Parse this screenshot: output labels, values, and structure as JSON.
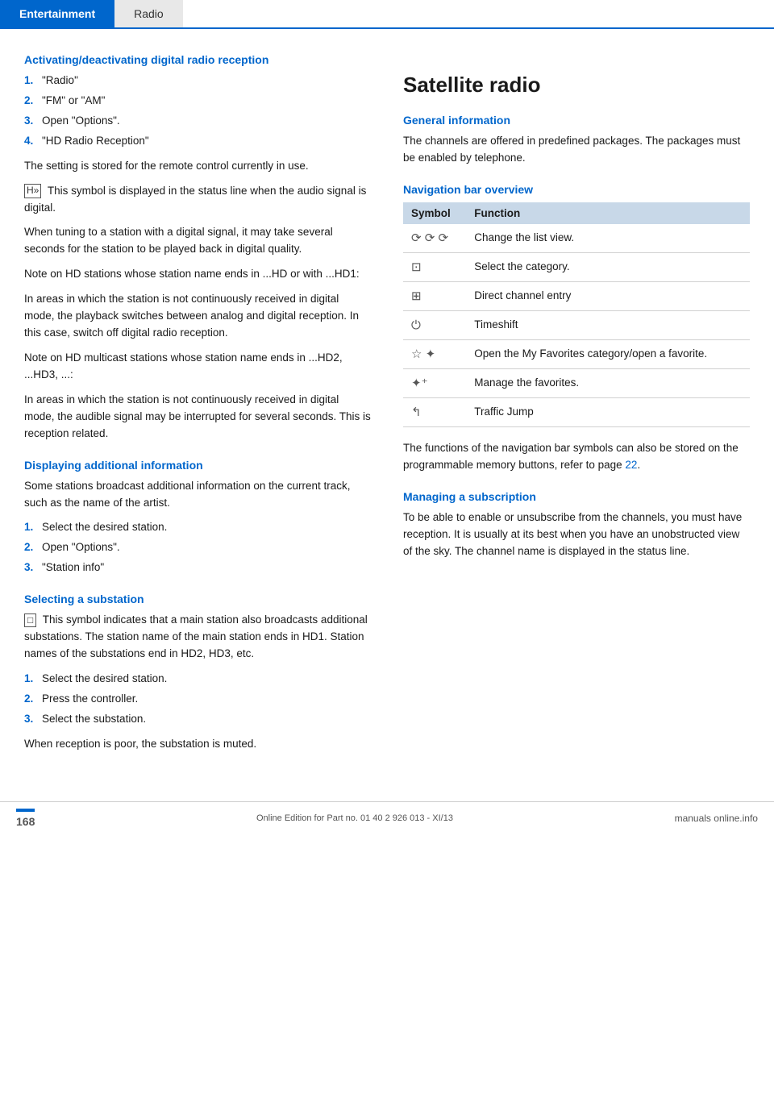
{
  "header": {
    "tab_active": "Entertainment",
    "tab_inactive": "Radio"
  },
  "left_col": {
    "section1_title": "Activating/deactivating digital radio reception",
    "section1_steps": [
      {
        "num": "1.",
        "text": "\"Radio\""
      },
      {
        "num": "2.",
        "text": "\"FM\" or \"AM\""
      },
      {
        "num": "3.",
        "text": "Open \"Options\"."
      },
      {
        "num": "4.",
        "text": "\"HD Radio Reception\""
      }
    ],
    "section1_para1": "The setting is stored for the remote control currently in use.",
    "section1_para2": "This symbol is displayed in the status line when the audio signal is digital.",
    "section1_para3": "When tuning to a station with a digital signal, it may take several seconds for the station to be played back in digital quality.",
    "section1_para4": "Note on HD stations whose station name ends in ...HD or with ...HD1:",
    "section1_para5": "In areas in which the station is not continuously received in digital mode, the playback switches between analog and digital reception. In this case, switch off digital radio reception.",
    "section1_para6": "Note on HD multicast stations whose station name ends in ...HD2, ...HD3, ...:",
    "section1_para7": "In areas in which the station is not continuously received in digital mode, the audible signal may be interrupted for several seconds. This is reception related.",
    "section2_title": "Displaying additional information",
    "section2_para1": "Some stations broadcast additional information on the current track, such as the name of the artist.",
    "section2_steps": [
      {
        "num": "1.",
        "text": "Select the desired station."
      },
      {
        "num": "2.",
        "text": "Open \"Options\"."
      },
      {
        "num": "3.",
        "text": "\"Station info\""
      }
    ],
    "section3_title": "Selecting a substation",
    "section3_para1": "This symbol indicates that a main station also broadcasts additional substations. The station name of the main station ends in HD1. Station names of the substations end in HD2, HD3, etc.",
    "section3_steps": [
      {
        "num": "1.",
        "text": "Select the desired station."
      },
      {
        "num": "2.",
        "text": "Press the controller."
      },
      {
        "num": "3.",
        "text": "Select the substation."
      }
    ],
    "section3_para2": "When reception is poor, the substation is muted."
  },
  "right_col": {
    "big_title": "Satellite radio",
    "section1_title": "General information",
    "section1_para": "The channels are offered in predefined packages. The packages must be enabled by telephone.",
    "section2_title": "Navigation bar overview",
    "table": {
      "col1": "Symbol",
      "col2": "Function",
      "rows": [
        {
          "sym": "⟳  ⟳  ⟳",
          "func": "Change the list view."
        },
        {
          "sym": "⊡",
          "func": "Select the category."
        },
        {
          "sym": "⊞",
          "func": "Direct channel entry"
        },
        {
          "sym": "⏻",
          "func": "Timeshift"
        },
        {
          "sym": "☆  ✦",
          "func": "Open the My Favorites category/open a favorite."
        },
        {
          "sym": "✦⁺",
          "func": "Manage the favorites."
        },
        {
          "sym": "↰",
          "func": "Traffic Jump"
        }
      ]
    },
    "section2_para": "The functions of the navigation bar symbols can also be stored on the programmable memory buttons, refer to page",
    "section2_page_link": "22",
    "section3_title": "Managing a subscription",
    "section3_para": "To be able to enable or unsubscribe from the channels, you must have reception. It is usually at its best when you have an unobstructed view of the sky. The channel name is displayed in the status line."
  },
  "footer": {
    "page_number": "168",
    "edition_text": "Online Edition for Part no. 01 40 2 926 013 - XI/13",
    "brand": "manuals online.info"
  }
}
